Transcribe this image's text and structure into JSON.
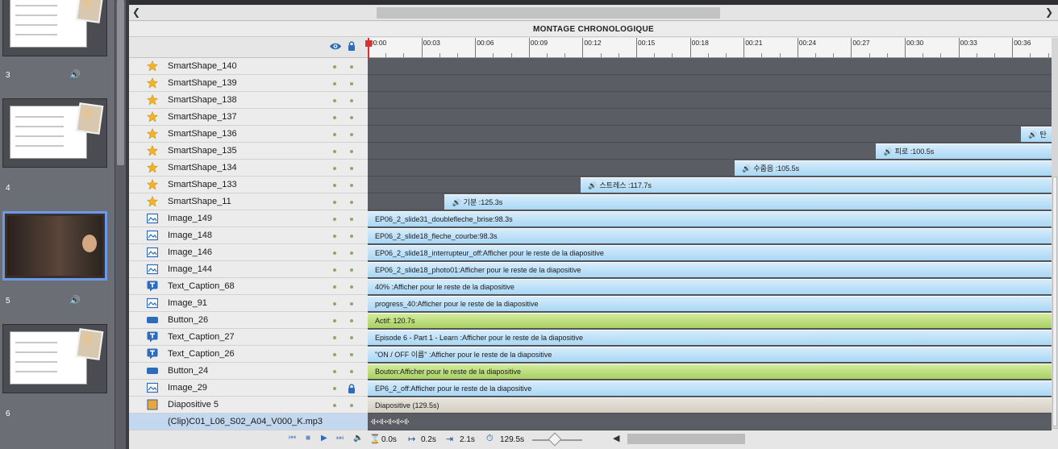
{
  "colors": {
    "accent_selected": "#6a9ae8",
    "playhead": "#d83030",
    "bar_blue": "#a9d7f4",
    "bar_green": "#a9d063",
    "bar_tan": "#d3cdc1"
  },
  "filmstrip": {
    "slides": [
      {
        "number": "3",
        "selected": false,
        "has_audio": true
      },
      {
        "number": "4",
        "selected": false,
        "has_audio": false
      },
      {
        "number": "5",
        "selected": true,
        "has_audio": true
      },
      {
        "number": "6",
        "selected": false,
        "has_audio": false
      }
    ]
  },
  "timeline": {
    "title": "MONTAGE CHRONOLOGIQUE",
    "header_icons": [
      "eye-icon",
      "lock-icon"
    ],
    "ruler_labels": [
      "00:00",
      "00:03",
      "00:06",
      "00:09",
      "00:12",
      "00:15",
      "00:18",
      "00:21",
      "00:24",
      "00:27",
      "00:30",
      "00:33",
      "00:36"
    ],
    "ruler_seconds_visible": [
      0,
      38
    ]
  },
  "layers": [
    {
      "name": "SmartShape_140",
      "icon": "star-icon",
      "locked": false,
      "bar": null
    },
    {
      "name": "SmartShape_139",
      "icon": "star-icon",
      "locked": false,
      "bar": null
    },
    {
      "name": "SmartShape_138",
      "icon": "star-icon",
      "locked": false,
      "bar": null
    },
    {
      "name": "SmartShape_137",
      "icon": "star-icon",
      "locked": false,
      "bar": null
    },
    {
      "name": "SmartShape_136",
      "icon": "star-icon",
      "locked": false,
      "bar": {
        "text": "탄",
        "style": "blue",
        "audio": true,
        "start_sec": 36.5
      }
    },
    {
      "name": "SmartShape_135",
      "icon": "star-icon",
      "locked": false,
      "bar": {
        "text": "피로 :100.5s",
        "style": "blue",
        "audio": true,
        "start_sec": 28.4
      }
    },
    {
      "name": "SmartShape_134",
      "icon": "star-icon",
      "locked": false,
      "bar": {
        "text": "수줍음 :105.5s",
        "style": "blue",
        "audio": true,
        "start_sec": 20.5
      }
    },
    {
      "name": "SmartShape_133",
      "icon": "star-icon",
      "locked": false,
      "bar": {
        "text": "스트레스 :117.7s",
        "style": "blue",
        "audio": true,
        "start_sec": 11.9
      }
    },
    {
      "name": "SmartShape_11",
      "icon": "star-icon",
      "locked": false,
      "bar": {
        "text": "기분 :125.3s",
        "style": "blue",
        "audio": true,
        "start_sec": 4.3
      }
    },
    {
      "name": "Image_149",
      "icon": "image-icon",
      "locked": false,
      "bar": {
        "text": "EP06_2_slide31_doublefleche_brise:98.3s",
        "style": "blue",
        "audio": false,
        "start_sec": 0
      }
    },
    {
      "name": "Image_148",
      "icon": "image-icon",
      "locked": false,
      "bar": {
        "text": "EP06_2_slide18_fleche_courbe:98.3s",
        "style": "blue",
        "audio": false,
        "start_sec": 0
      }
    },
    {
      "name": "Image_146",
      "icon": "image-icon",
      "locked": false,
      "bar": {
        "text": "EP06_2_slide18_interrupteur_off:Afficher pour le reste de la diapositive",
        "style": "blue",
        "audio": false,
        "start_sec": 0
      }
    },
    {
      "name": "Image_144",
      "icon": "image-icon",
      "locked": false,
      "bar": {
        "text": "EP06_2_slide18_photo01:Afficher pour le reste de la diapositive",
        "style": "blue",
        "audio": false,
        "start_sec": 0
      }
    },
    {
      "name": "Text_Caption_68",
      "icon": "caption-icon",
      "locked": false,
      "bar": {
        "text": "40% :Afficher pour le reste de la diapositive",
        "style": "blue",
        "audio": false,
        "start_sec": 0
      }
    },
    {
      "name": "Image_91",
      "icon": "image-icon",
      "locked": false,
      "bar": {
        "text": "progress_40:Afficher pour le reste de la diapositive",
        "style": "blue",
        "audio": false,
        "start_sec": 0
      }
    },
    {
      "name": "Button_26",
      "icon": "button-icon",
      "locked": false,
      "bar": {
        "text": "Actif: 120.7s",
        "style": "green",
        "audio": false,
        "start_sec": 0
      }
    },
    {
      "name": "Text_Caption_27",
      "icon": "caption-icon",
      "locked": false,
      "bar": {
        "text": "Episode 6 - Part 1 - Learn :Afficher pour le reste de la diapositive",
        "style": "blue",
        "audio": false,
        "start_sec": 0
      }
    },
    {
      "name": "Text_Caption_26",
      "icon": "caption-icon",
      "locked": false,
      "bar": {
        "text": "\"ON / OFF 이름\" :Afficher pour le reste de la diapositive",
        "style": "blue",
        "audio": false,
        "start_sec": 0
      }
    },
    {
      "name": "Button_24",
      "icon": "button-icon",
      "locked": false,
      "bar": {
        "text": "Bouton:Afficher pour le reste de la diapositive",
        "style": "green",
        "audio": false,
        "start_sec": 0
      }
    },
    {
      "name": "Image_29",
      "icon": "image-icon",
      "locked": true,
      "bar": {
        "text": "EP6_2_off:Afficher pour le reste de la diapositive",
        "style": "blue",
        "audio": false,
        "start_sec": 0
      }
    },
    {
      "name": "Diapositive 5",
      "icon": "slide-icon",
      "locked": false,
      "bar": {
        "text": "Diapositive (129.5s)",
        "style": "tan",
        "audio": false,
        "start_sec": 0
      }
    },
    {
      "name": "(Clip)C01_L06_S02_A04_V000_K.mp3",
      "icon": "",
      "locked": false,
      "clip": true,
      "bar": {
        "text": "",
        "style": "wave",
        "audio": false,
        "start_sec": 0
      }
    }
  ],
  "status": {
    "start": "0.0s",
    "lead_in": "0.2s",
    "duration": "2.1s",
    "total": "129.5s"
  },
  "zoom_fraction": 0.45
}
